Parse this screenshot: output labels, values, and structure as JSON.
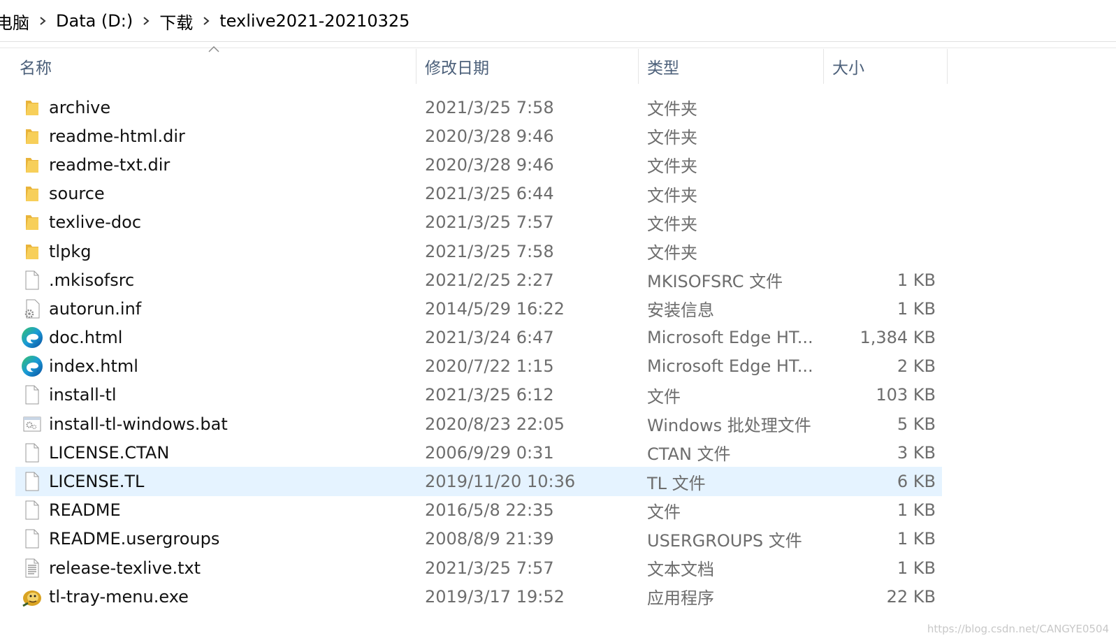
{
  "breadcrumb": {
    "items": [
      "电脑",
      "Data (D:)",
      "下载",
      "texlive2021-20210325"
    ]
  },
  "columns": {
    "name": "名称",
    "date": "修改日期",
    "type": "类型",
    "size": "大小"
  },
  "files": [
    {
      "name": "archive",
      "date": "2021/3/25 7:58",
      "type": "文件夹",
      "size": "",
      "icon": "folder-icon"
    },
    {
      "name": "readme-html.dir",
      "date": "2020/3/28 9:46",
      "type": "文件夹",
      "size": "",
      "icon": "folder-icon"
    },
    {
      "name": "readme-txt.dir",
      "date": "2020/3/28 9:46",
      "type": "文件夹",
      "size": "",
      "icon": "folder-icon"
    },
    {
      "name": "source",
      "date": "2021/3/25 6:44",
      "type": "文件夹",
      "size": "",
      "icon": "folder-icon"
    },
    {
      "name": "texlive-doc",
      "date": "2021/3/25 7:57",
      "type": "文件夹",
      "size": "",
      "icon": "folder-icon"
    },
    {
      "name": "tlpkg",
      "date": "2021/3/25 7:58",
      "type": "文件夹",
      "size": "",
      "icon": "folder-icon"
    },
    {
      "name": ".mkisofsrc",
      "date": "2021/2/25 2:27",
      "type": "MKISOFSRC 文件",
      "size": "1 KB",
      "icon": "file-icon"
    },
    {
      "name": "autorun.inf",
      "date": "2014/5/29 16:22",
      "type": "安装信息",
      "size": "1 KB",
      "icon": "setup-info-icon"
    },
    {
      "name": "doc.html",
      "date": "2021/3/24 6:47",
      "type": "Microsoft Edge HT...",
      "size": "1,384 KB",
      "icon": "edge-icon"
    },
    {
      "name": "index.html",
      "date": "2020/7/22 1:15",
      "type": "Microsoft Edge HT...",
      "size": "2 KB",
      "icon": "edge-icon"
    },
    {
      "name": "install-tl",
      "date": "2021/3/25 6:12",
      "type": "文件",
      "size": "103 KB",
      "icon": "file-icon"
    },
    {
      "name": "install-tl-windows.bat",
      "date": "2020/8/23 22:05",
      "type": "Windows 批处理文件",
      "size": "5 KB",
      "icon": "batch-file-icon"
    },
    {
      "name": "LICENSE.CTAN",
      "date": "2006/9/29 0:31",
      "type": "CTAN 文件",
      "size": "3 KB",
      "icon": "file-icon"
    },
    {
      "name": "LICENSE.TL",
      "date": "2019/11/20 10:36",
      "type": "TL 文件",
      "size": "6 KB",
      "icon": "file-icon",
      "selected": true
    },
    {
      "name": "README",
      "date": "2016/5/8 22:35",
      "type": "文件",
      "size": "1 KB",
      "icon": "file-icon"
    },
    {
      "name": "README.usergroups",
      "date": "2008/8/9 21:39",
      "type": "USERGROUPS 文件",
      "size": "1 KB",
      "icon": "file-icon"
    },
    {
      "name": "release-texlive.txt",
      "date": "2021/3/25 7:57",
      "type": "文本文档",
      "size": "1 KB",
      "icon": "text-file-icon"
    },
    {
      "name": "tl-tray-menu.exe",
      "date": "2019/3/17 19:52",
      "type": "应用程序",
      "size": "22 KB",
      "icon": "tex-lion-icon"
    }
  ],
  "watermark": "https://blog.csdn.net/CANGYE0504",
  "colors": {
    "selection": "#e5f3ff",
    "header_text": "#4c607a",
    "folder": "#f7c948",
    "edge_blue": "#0c59a4",
    "edge_green": "#3fbf6d"
  }
}
